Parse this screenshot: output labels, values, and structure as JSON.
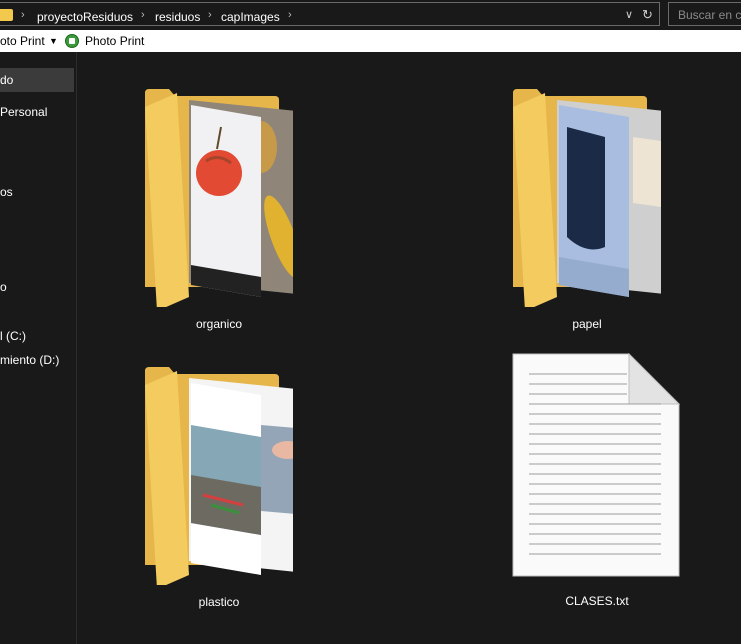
{
  "address_bar": {
    "breadcrumb": [
      "proyectoResiduos",
      "residuos",
      "capImages"
    ],
    "search_placeholder": "Buscar en ca"
  },
  "toolbar": {
    "items": [
      "oto Print",
      "Photo Print"
    ]
  },
  "sidebar": {
    "items": [
      "do",
      "Personal",
      "os",
      "o",
      "l (C:)",
      "miento (D:)"
    ],
    "selected_index": 0
  },
  "files": [
    {
      "name": "organico",
      "type": "folder"
    },
    {
      "name": "papel",
      "type": "folder"
    },
    {
      "name": "plastico",
      "type": "folder"
    },
    {
      "name": "CLASES.txt",
      "type": "text-file"
    }
  ],
  "colors": {
    "background": "#191919",
    "folder_yellow": "#f2c94c",
    "toolbar_bg": "#ffffff"
  }
}
